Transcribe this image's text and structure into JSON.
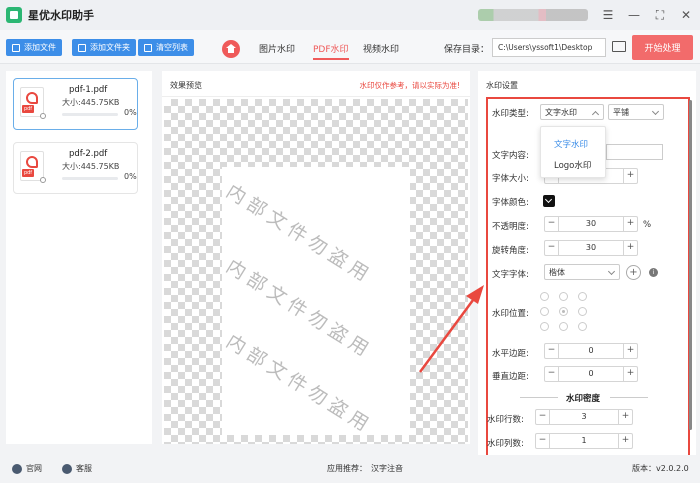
{
  "app": {
    "title": "星优水印助手"
  },
  "window_controls": {
    "menu_icon": "sliders-icon",
    "minimize": "—",
    "maximize": "⛶",
    "close": "✕"
  },
  "toolbar": {
    "add_file": "添加文件",
    "add_folder": "添加文件夹",
    "clear_list": "清空列表",
    "tabs": [
      "图片水印",
      "PDF水印",
      "视频水印"
    ],
    "active_tab": "PDF水印",
    "save_dir_label": "保存目录：",
    "save_dir_value": "C:\\Users\\yssoft1\\Desktop",
    "start_button": "开始处理"
  },
  "files": [
    {
      "name": "pdf-1.pdf",
      "size": "大小:445.75KB",
      "progress": "0%",
      "selected": true
    },
    {
      "name": "pdf-2.pdf",
      "size": "大小:445.75KB",
      "progress": "0%",
      "selected": false
    }
  ],
  "preview": {
    "title": "效果预览",
    "note": "水印仅作参考，请以实际为准!",
    "watermark_text": "内部文件勿盗用"
  },
  "settings": {
    "header": "水印设置",
    "type_label": "水印类型:",
    "type_value": "文字水印",
    "tile_value": "平铺",
    "dropdown_options": [
      "文字水印",
      "Logo水印"
    ],
    "text_label": "文字内容:",
    "font_size_label": "字体大小:",
    "font_color_label": "字体颜色:",
    "opacity_label": "不透明度:",
    "opacity_value": "30",
    "opacity_unit": "%",
    "rotation_label": "旋转角度:",
    "rotation_value": "30",
    "font_family_label": "文字字体:",
    "font_family_value": "楷体",
    "position_label": "水印位置:",
    "h_margin_label": "水平边距:",
    "h_margin_value": "0",
    "v_margin_label": "垂直边距:",
    "v_margin_value": "0",
    "density_title": "水印密度",
    "rows_label": "水印行数:",
    "rows_value": "3",
    "cols_label": "水印列数:",
    "cols_value": "1",
    "minus": "−",
    "plus": "+"
  },
  "footer": {
    "website": "官网",
    "support": "客服",
    "recommend": "应用推荐：",
    "recommend_app": "汉字注音",
    "version": "版本：v2.0.2.0"
  }
}
